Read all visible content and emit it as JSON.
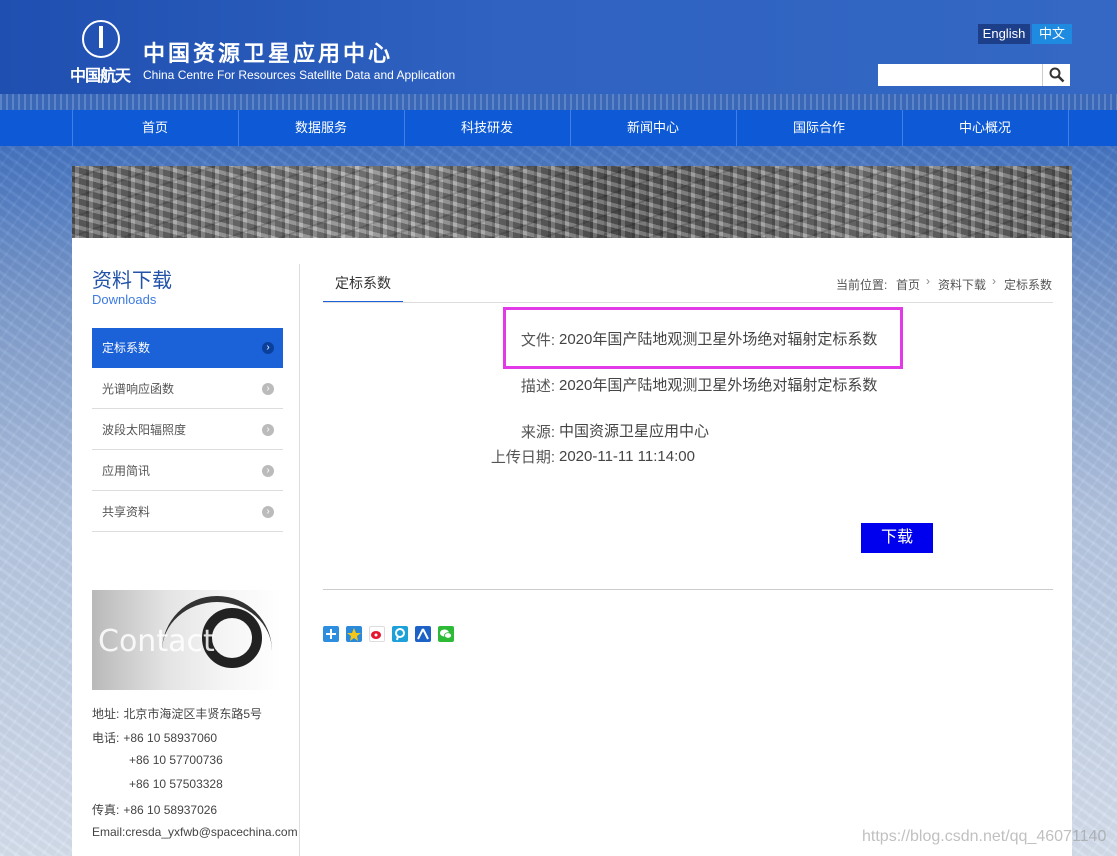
{
  "header": {
    "logo_text": "中国航天",
    "title_cn": "中国资源卫星应用中心",
    "title_en": "China Centre For Resources Satellite Data and Application",
    "lang_en": "English",
    "lang_cn": "中文",
    "search_placeholder": ""
  },
  "nav": [
    "首页",
    "数据服务",
    "科技研发",
    "新闻中心",
    "国际合作",
    "中心概况"
  ],
  "sidebar": {
    "title": "资料下载",
    "subtitle": "Downloads",
    "items": [
      {
        "label": "定标系数",
        "active": true
      },
      {
        "label": "光谱响应函数",
        "active": false
      },
      {
        "label": "波段太阳辐照度",
        "active": false
      },
      {
        "label": "应用简讯",
        "active": false
      },
      {
        "label": "共享资料",
        "active": false
      }
    ],
    "contact_image_text": "Contact",
    "contact": {
      "address_label": "地址:",
      "address": "北京市海淀区丰贤东路5号",
      "phone_label": "电话:",
      "phones": [
        "+86 10 58937060",
        "+86 10 57700736",
        "+86 10 57503328"
      ],
      "fax_label": "传真:",
      "fax": "+86 10 58937026",
      "email": "Email:cresda_yxfwb@spacechina.com"
    }
  },
  "content": {
    "tab": "定标系数",
    "breadcrumb": {
      "label": "当前位置:",
      "items": [
        "首页",
        "资料下载",
        "定标系数"
      ]
    },
    "fields": {
      "file_label": "文件:",
      "file_value": "2020年国产陆地观测卫星外场绝对辐射定标系数",
      "desc_label": "描述:",
      "desc_value": "2020年国产陆地观测卫星外场绝对辐射定标系数",
      "source_label": "来源:",
      "source_value": "中国资源卫星应用中心",
      "date_label": "上传日期:",
      "date_value": "2020-11-11 11:14:00"
    },
    "download_label": "下载",
    "share_icons": [
      "share-plus-icon",
      "qzone-icon",
      "weibo-icon",
      "tencent-weibo-icon",
      "renren-icon",
      "wechat-icon"
    ]
  },
  "watermark": "https://blog.csdn.net/qq_46071140",
  "colors": {
    "nav_bg": "#0e5ad6",
    "active_item": "#1b61d8",
    "download_btn": "#0000ee",
    "highlight_border": "#e23ae6"
  }
}
